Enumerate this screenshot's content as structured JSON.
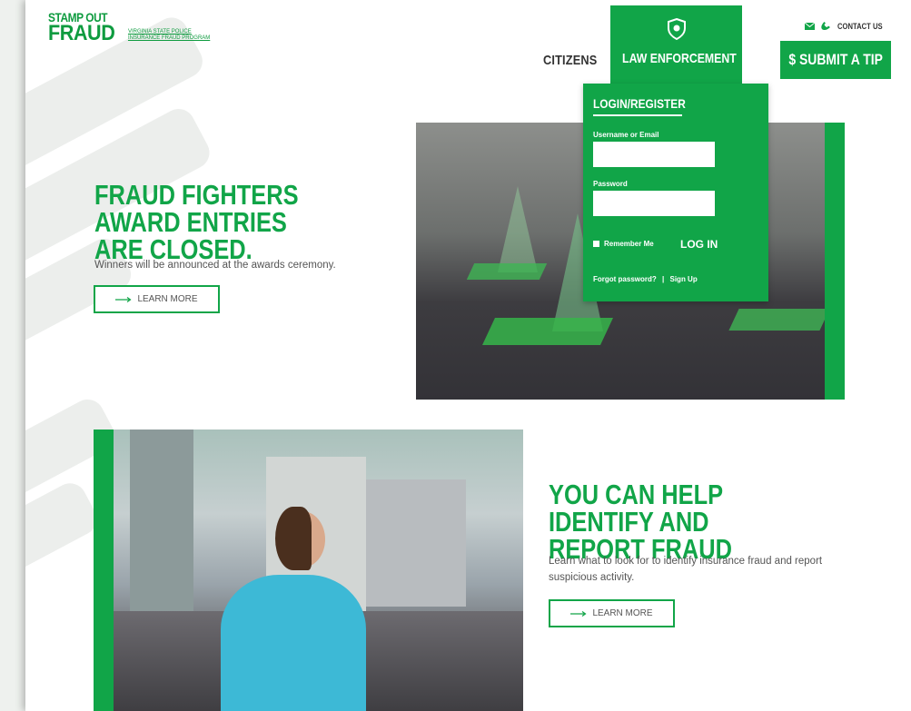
{
  "header": {
    "logo_top": "STAMP OUT",
    "logo_main": "FRAUD",
    "logo_sub_1": "VIRGINIA STATE POLICE",
    "logo_sub_2": "INSURANCE FRAUD PROGRAM",
    "nav_citizens": "CITIZENS",
    "nav_law_enforcement": "LAW ENFORCEMENT",
    "contact_us": "CONTACT US",
    "submit_tip": "$ SUBMIT A TIP"
  },
  "login": {
    "title": "LOGIN/REGISTER",
    "username_label": "Username or Email",
    "username_value": "",
    "password_label": "Password",
    "password_value": "",
    "remember_me": "Remember Me",
    "login_button": "LOG IN",
    "forgot_password": "Forgot password?",
    "separator": "|",
    "sign_up": "Sign Up"
  },
  "hero1": {
    "title": "FRAUD FIGHTERS AWARD ENTRIES ARE CLOSED.",
    "text": "Winners will be announced at the awards ceremony.",
    "button": "LEARN MORE"
  },
  "hero2": {
    "title": "YOU CAN HELP IDENTIFY AND REPORT FRAUD",
    "text": "Learn what to look for to identify insurance fraud and report suspicious activity.",
    "button": "LEARN MORE"
  },
  "colors": {
    "brand_green": "#11a548",
    "text_gray": "#555555"
  },
  "icons": [
    "shield-icon",
    "envelope-icon",
    "phone-icon",
    "arrow-right-icon"
  ]
}
